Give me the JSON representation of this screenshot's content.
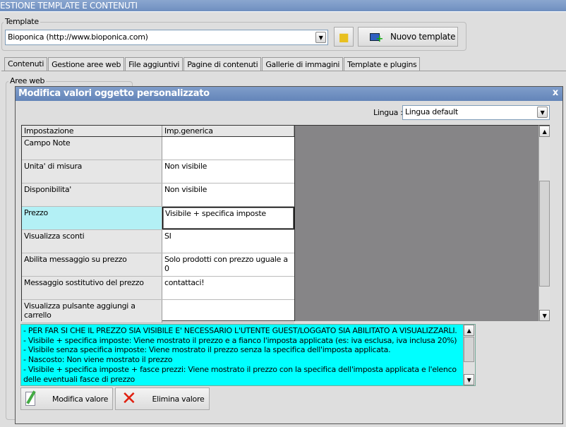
{
  "app": {
    "title": "ESTIONE TEMPLATE E CONTENUTI"
  },
  "template": {
    "legend": "Template",
    "value": "Bioponica (http://www.bioponica.com)",
    "new_label": "Nuovo template"
  },
  "tabs": [
    {
      "label": "Contenuti"
    },
    {
      "label": "Gestione aree web"
    },
    {
      "label": "File aggiuntivi"
    },
    {
      "label": "Pagine di contenuti"
    },
    {
      "label": "Gallerie di immagini"
    },
    {
      "label": "Template e plugins"
    }
  ],
  "background": {
    "aree_legend": "Aree web"
  },
  "dialog": {
    "title": "Modifica valori oggetto personalizzato",
    "close": "x",
    "lingua_label": "Lingua :",
    "lingua_value": "Lingua default",
    "grid": {
      "headers": [
        "Impostazione",
        "Imp.generica"
      ],
      "rows": [
        {
          "setting": "Campo Note",
          "value": ""
        },
        {
          "setting": "Unita' di misura",
          "value": "Non visibile"
        },
        {
          "setting": "Disponibilita'",
          "value": "Non visibile"
        },
        {
          "setting": "Prezzo",
          "value": "Visibile + specifica imposte",
          "selected": true
        },
        {
          "setting": "Visualizza sconti",
          "value": "SI"
        },
        {
          "setting": "Abilita messaggio su prezzo",
          "value": "Solo prodotti con prezzo uguale a 0"
        },
        {
          "setting": "Messaggio sostitutivo del prezzo",
          "value": "contattaci!"
        },
        {
          "setting": "Visualizza pulsante aggiungi a carrello",
          "value": ""
        }
      ]
    },
    "info_lines": [
      "- PER FAR SI CHE IL PREZZO SIA VISIBILE E' NECESSARIO L'UTENTE GUEST/LOGGATO SIA ABILITATO A VISUALIZZARLI.",
      "- Visibile + specifica imposte: Viene mostrato il prezzo e a fianco l'imposta applicata (es: iva esclusa, iva inclusa 20%)",
      "- Visibile senza specifica imposte: Viene mostrato il prezzo senza la specifica dell'imposta applicata.",
      "- Nascosto: Non viene mostrato il prezzo",
      "- Visibile + specifica imposte + fasce prezzi: Viene mostrato il prezzo con la specifica dell'imposta applicata e l'elenco delle eventuali fasce di prezzo"
    ],
    "info_bg": "#00ffff",
    "modify_label": "Modifica valore",
    "delete_label": "Elimina valore"
  }
}
